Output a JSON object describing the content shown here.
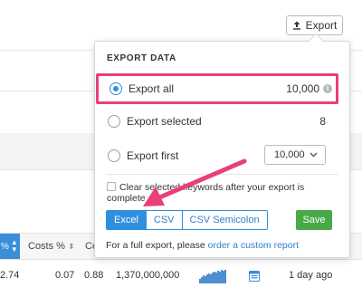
{
  "toolbar": {
    "export_label": "Export",
    "export_icon": "upload-icon"
  },
  "export_panel": {
    "title": "EXPORT DATA",
    "options": [
      {
        "label": "Export all",
        "count": "10,000",
        "selected": true,
        "info_icon": "info-icon"
      },
      {
        "label": "Export selected",
        "count": "8",
        "selected": false
      },
      {
        "label": "Export first",
        "selected": false,
        "select_value": "10,000"
      }
    ],
    "clear_checkbox_label": "Clear selected keywords after your export is complete",
    "clear_checked": false,
    "formats": [
      "Excel",
      "CSV",
      "CSV Semicolon"
    ],
    "active_format": "Excel",
    "save_label": "Save",
    "footer_text": "For a full export, please ",
    "footer_link": "order a custom report"
  },
  "table": {
    "header_first_fragment": "%",
    "headers": [
      "Costs %",
      "Co"
    ],
    "row": {
      "first": "2.74",
      "costs": "0.07",
      "co": "0.88",
      "volume": "1,370,000,000",
      "updated": "1 day ago"
    }
  },
  "colors": {
    "accent_blue": "#2f8fdf",
    "save_green": "#49a948",
    "highlight_pink": "#e8407a"
  }
}
